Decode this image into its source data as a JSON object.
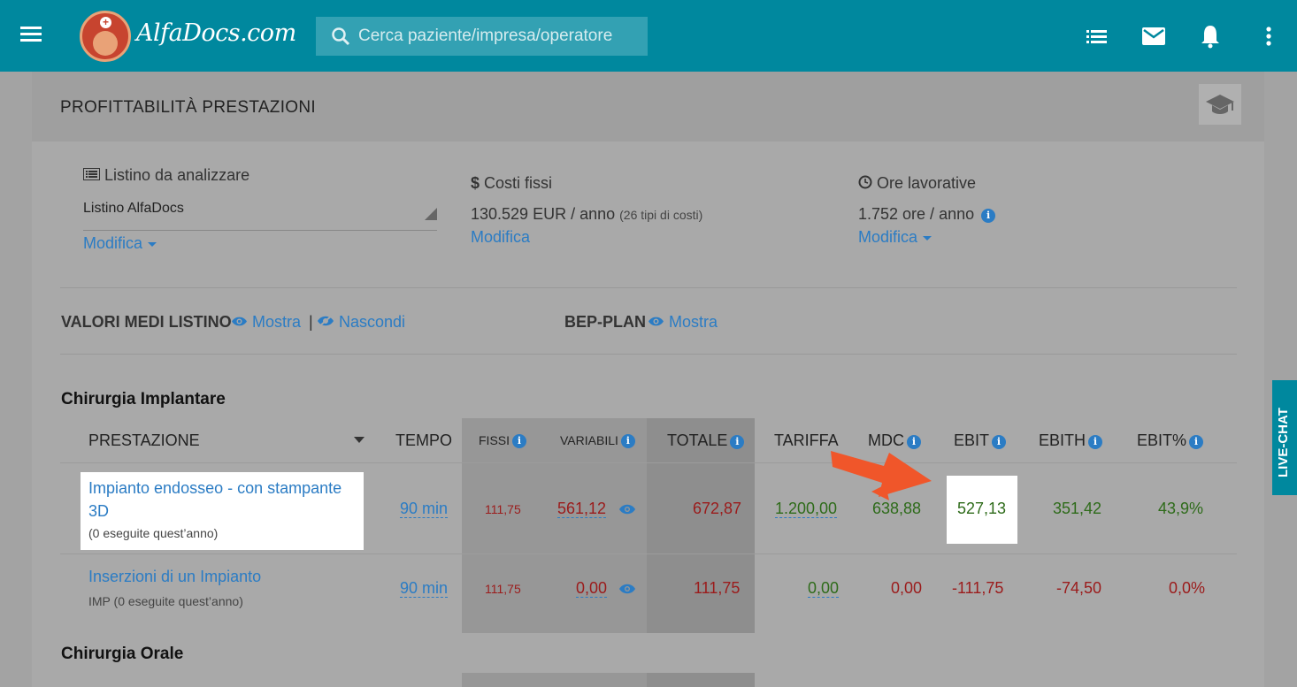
{
  "topbar": {
    "logo_text": "AlfaDocs.com",
    "search_placeholder": "Cerca paziente/impresa/operatore"
  },
  "page": {
    "title": "PROFITTABILITÀ PRESTAZIONI"
  },
  "listino": {
    "label": "Listino da analizzare",
    "value": "Listino AlfaDocs",
    "modify": "Modifica"
  },
  "costi": {
    "label": "Costi fissi",
    "value": "130.529 EUR / anno",
    "note": "(26 tipi di costi)",
    "modify": "Modifica"
  },
  "ore": {
    "label": "Ore lavorative",
    "value": "1.752 ore / anno",
    "modify": "Modifica"
  },
  "valori": {
    "label": "VALORI MEDI LISTINO",
    "show": "Mostra",
    "sep": "|",
    "hide": "Nascondi"
  },
  "bep": {
    "label": "BEP-PLAN",
    "show": "Mostra"
  },
  "sections": [
    "Chirurgia Implantare",
    "Chirurgia Orale"
  ],
  "columns": {
    "prestazione": "PRESTAZIONE",
    "tempo": "TEMPO",
    "fissi": "FISSI",
    "variabili": "VARIABILI",
    "totale": "TOTALE",
    "tariffa": "TARIFFA",
    "mdc": "MDC",
    "ebit": "EBIT",
    "ebith": "EBITH",
    "ebitp": "EBIT%"
  },
  "rows": [
    {
      "name": "Impianto endosseo - con stampante 3D",
      "name_line1": "Impianto endosseo - con stampante",
      "name_line2": "3D",
      "sub": "(0 eseguite quest’anno)",
      "tempo": "90 min",
      "fissi": "111,75",
      "variabili": "561,12",
      "totale": "672,87",
      "tariffa": "1.200,00",
      "mdc": "638,88",
      "ebit": "527,13",
      "ebith": "351,42",
      "ebitp": "43,9%"
    },
    {
      "name": "Inserzioni di un Impianto",
      "sub": "IMP (0 eseguite quest’anno)",
      "tempo": "90 min",
      "fissi": "111,75",
      "variabili": "0,00",
      "totale": "111,75",
      "tariffa": "0,00",
      "mdc": "0,00",
      "ebit": "-111,75",
      "ebith": "-74,50",
      "ebitp": "0,0%"
    }
  ],
  "live_chat": "LIVE-CHAT",
  "colors": {
    "topbar": "#00889e",
    "link": "#2b7cc4",
    "negative": "#9b1b1b",
    "positive": "#2e6b1a",
    "arrow": "#f0562a"
  }
}
